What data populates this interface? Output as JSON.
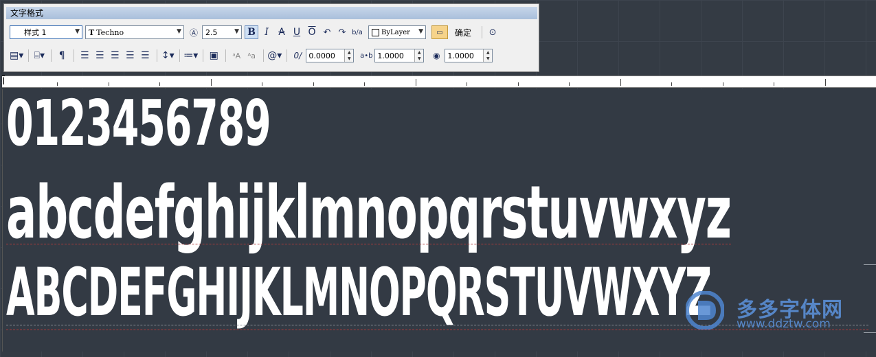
{
  "toolbar": {
    "title": "文字格式",
    "style_select": "样式 1",
    "font_select": "Techno",
    "height_select": "2.5",
    "underline_label": "U",
    "overline_label": "O",
    "stack_label": "b/a",
    "color_select": "ByLayer",
    "ok_label": "确定",
    "oblique_value": "0.0000",
    "tracking_value": "1.0000",
    "width_value": "1.0000"
  },
  "icons": [
    "annotative-icon",
    "bold-icon",
    "italic-icon",
    "strikethrough-icon",
    "underline-icon",
    "overline-icon",
    "undo-icon",
    "redo-icon",
    "stack-icon",
    "ruler-icon",
    "options-icon",
    "columns-icon",
    "mtext-justify-icon",
    "paragraph-icon",
    "align-left-icon",
    "align-center-icon",
    "align-right-icon",
    "justify-icon",
    "distribute-icon",
    "line-spacing-icon",
    "numbering-icon",
    "insert-field-icon",
    "uppercase-icon",
    "lowercase-icon",
    "symbol-icon",
    "oblique-icon",
    "tracking-icon",
    "width-factor-icon"
  ],
  "samples": {
    "digits": "0123456789",
    "lowercase": "abcdefghijklmnopqrstuvwxyz",
    "uppercase": "ABCDEFGHIJKLMNOPQRSTUVWXYZ"
  },
  "watermark": {
    "name": "多多字体网",
    "url": "www.ddztw.com"
  },
  "colors": {
    "canvas": "#333a44",
    "toolbar": "#f0f0f0",
    "title_bar": "#b7c9e2",
    "text": "#ffffff",
    "watermark": "#5a8fd6"
  }
}
